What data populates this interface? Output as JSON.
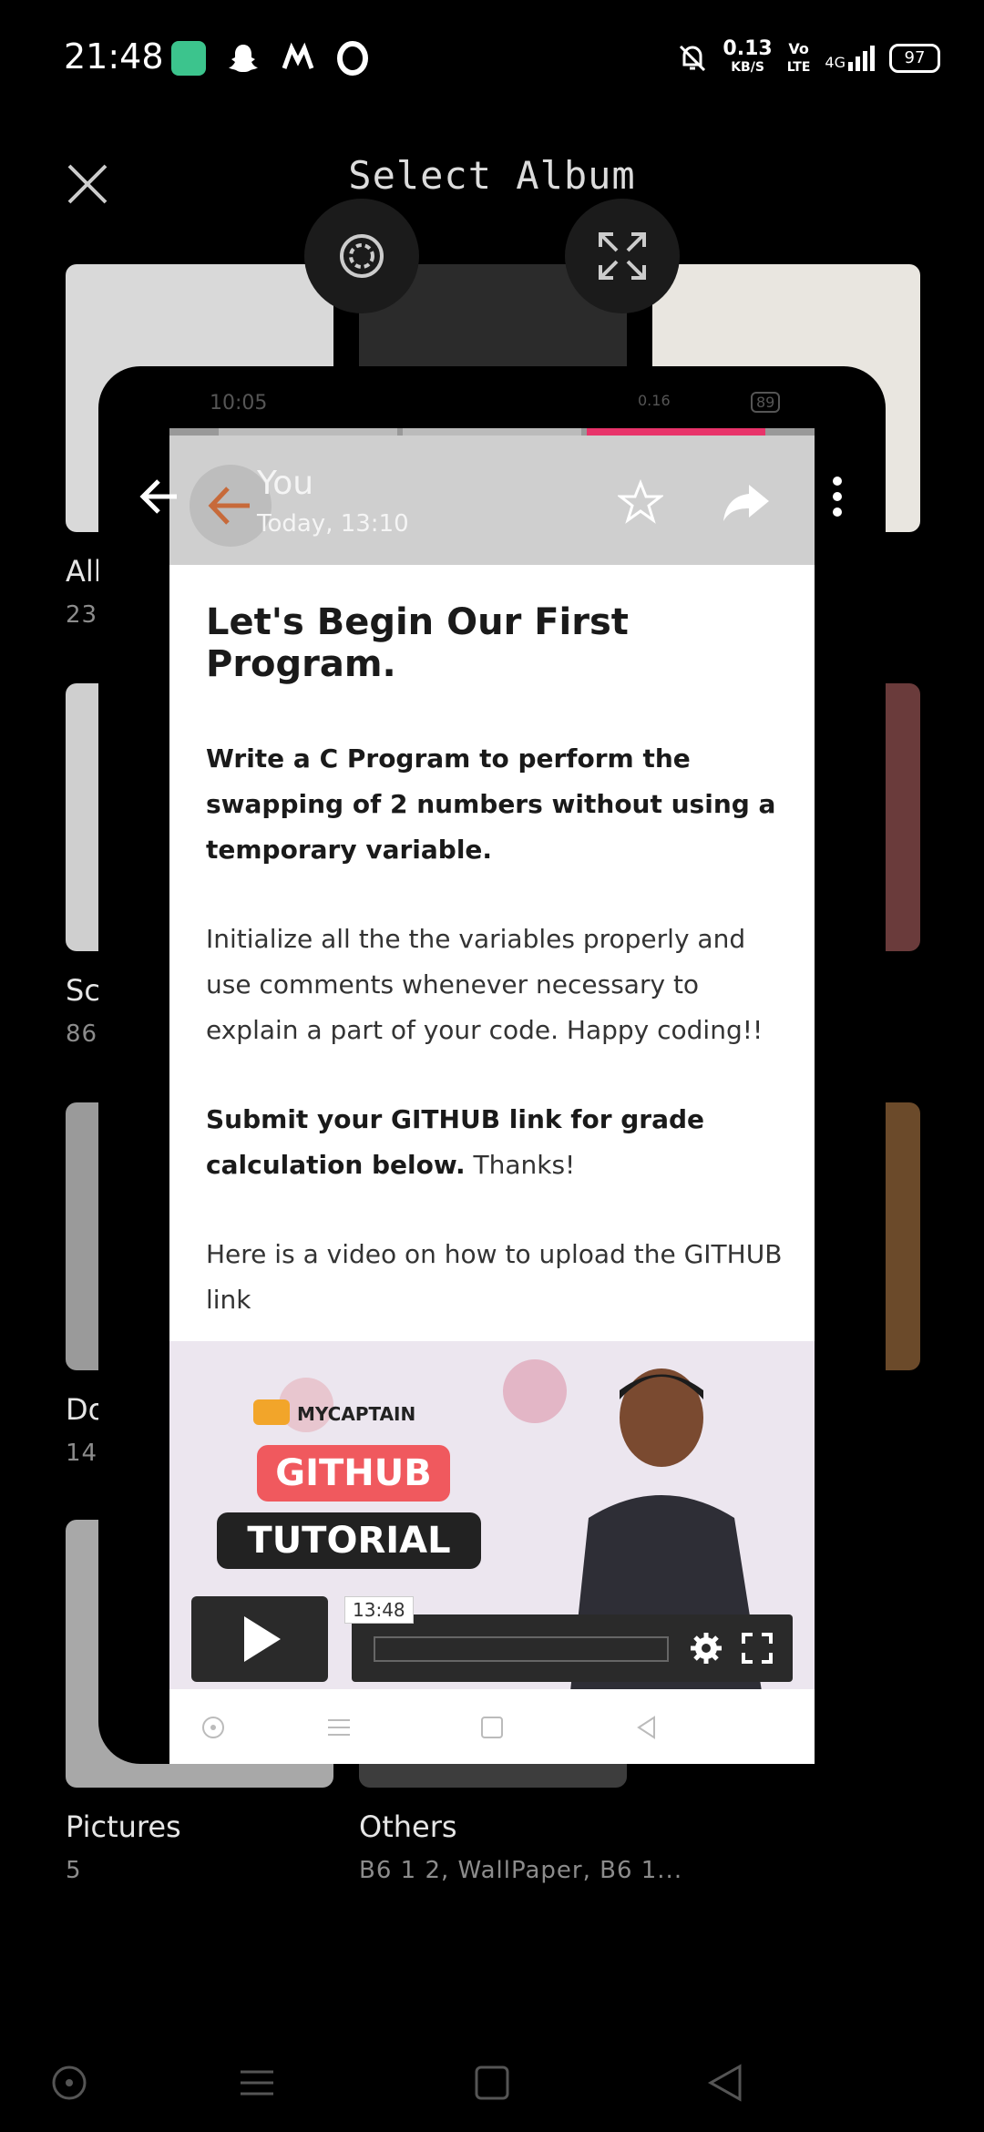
{
  "status_bar": {
    "time": "21:48",
    "net_speed": "0.13",
    "net_unit": "KB/S",
    "volte": "Vo",
    "network": "4G",
    "battery": "97"
  },
  "header": {
    "title": "Select Album"
  },
  "albums": [
    {
      "name": "All",
      "count": "23"
    },
    {
      "name": "Sc",
      "count": "86"
    },
    {
      "name": "Do",
      "count": "14"
    },
    {
      "name": "Pictures",
      "count": "5"
    },
    {
      "name": "Others",
      "count": "B6 1 2, WallPaper, B6 1..."
    }
  ],
  "preview": {
    "status_time": "10:05",
    "status_speed": "0.16",
    "status_battery": "89",
    "sender": "You",
    "timestamp": "Today, 13:10",
    "heading": "Let's Begin Our First Program.",
    "para1": "Write a C Program to perform the swapping of 2 numbers without using a temporary variable.",
    "para2": "Initialize all the the variables properly and use comments whenever necessary to explain a part of your code. Happy coding!!",
    "para3_bold": "Submit your GITHUB link for grade calculation below.",
    "para3_rest": " Thanks!",
    "para4": "Here is a video on how to upload the GITHUB link",
    "video": {
      "brand": "MYCAPTAIN",
      "label1": "GITHUB",
      "label2": "TUTORIAL",
      "time": "13:48"
    }
  },
  "colors": {
    "accent_pink": "#e8346a",
    "back_arrow_orange": "#c76a3a",
    "github_red": "#f0595e"
  },
  "icons": [
    "close-icon",
    "record-icon",
    "expand-icon",
    "back-arrow-icon",
    "star-icon",
    "share-icon",
    "more-icon",
    "play-icon",
    "gear-icon",
    "fullscreen-icon",
    "nav-home-icon",
    "nav-menu-icon",
    "nav-recents-icon",
    "nav-back-icon"
  ]
}
